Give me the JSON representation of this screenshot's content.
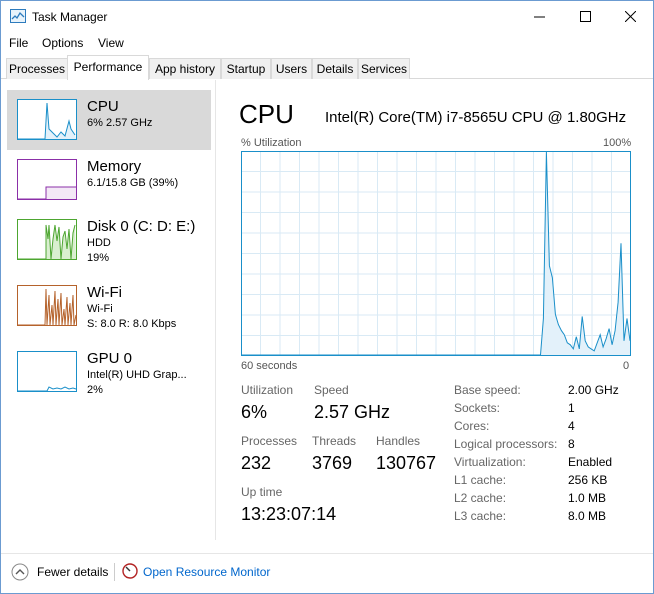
{
  "window": {
    "title": "Task Manager"
  },
  "menu": [
    "File",
    "Options",
    "View"
  ],
  "tabs": [
    "Processes",
    "Performance",
    "App history",
    "Startup",
    "Users",
    "Details",
    "Services"
  ],
  "active_tab": "Performance",
  "resources": [
    {
      "name": "CPU",
      "lines": [
        "6% 2.57 GHz"
      ],
      "color": "#1a8fc9"
    },
    {
      "name": "Memory",
      "lines": [
        "6.1/15.8 GB (39%)"
      ],
      "color": "#8b2fa8",
      "level": 0.39
    },
    {
      "name": "Disk 0 (C: D: E:)",
      "lines": [
        "HDD",
        "19%"
      ],
      "color": "#4da630"
    },
    {
      "name": "Wi-Fi",
      "lines": [
        "Wi-Fi",
        "S: 8.0 R: 8.0 Kbps"
      ],
      "color": "#b5622b"
    },
    {
      "name": "GPU 0",
      "lines": [
        "Intel(R) UHD Grap...",
        "2%"
      ],
      "color": "#1a8fc9"
    }
  ],
  "detail": {
    "title": "CPU",
    "model": "Intel(R) Core(TM) i7-8565U CPU @ 1.80GHz",
    "util_label": "% Utilization",
    "util_max": "100%",
    "axis_left": "60 seconds",
    "axis_right": "0",
    "stats": {
      "utilization_label": "Utilization",
      "utilization": "6%",
      "speed_label": "Speed",
      "speed": "2.57 GHz",
      "processes_label": "Processes",
      "processes": "232",
      "threads_label": "Threads",
      "threads": "3769",
      "handles_label": "Handles",
      "handles": "130767",
      "uptime_label": "Up time",
      "uptime": "13:23:07:14"
    },
    "specs": [
      {
        "label": "Base speed:",
        "value": "2.00 GHz"
      },
      {
        "label": "Sockets:",
        "value": "1"
      },
      {
        "label": "Cores:",
        "value": "4"
      },
      {
        "label": "Logical processors:",
        "value": "8"
      },
      {
        "label": "Virtualization:",
        "value": "Enabled"
      },
      {
        "label": "L1 cache:",
        "value": "256 KB"
      },
      {
        "label": "L2 cache:",
        "value": "1.0 MB"
      },
      {
        "label": "L3 cache:",
        "value": "8.0 MB"
      }
    ]
  },
  "cpu_history": [
    0,
    0,
    0,
    0,
    0,
    0,
    0,
    0,
    0,
    0,
    0,
    0,
    0,
    0,
    0,
    0,
    0,
    0,
    0,
    0,
    0,
    0,
    0,
    0,
    0,
    0,
    0,
    0,
    0,
    0,
    0,
    0,
    0,
    0,
    0,
    0,
    0,
    0,
    0,
    0,
    0,
    0,
    0,
    0,
    0,
    0,
    0,
    0,
    0,
    0,
    0,
    0,
    0,
    0,
    0,
    0,
    0,
    0,
    0,
    0,
    0,
    0,
    0,
    0,
    0,
    0,
    0,
    0,
    0,
    0,
    0,
    0,
    0,
    0,
    0,
    0,
    0,
    0,
    0,
    0,
    0,
    0,
    0,
    0,
    0,
    0,
    0,
    0,
    0,
    0,
    0,
    0,
    0,
    0,
    0,
    0,
    0,
    0,
    0,
    0,
    0,
    18,
    100,
    44,
    38,
    20,
    15,
    12,
    10,
    6,
    5,
    3,
    9,
    3,
    19,
    7,
    4,
    3,
    2,
    6,
    10,
    4,
    8,
    13,
    5,
    12,
    26,
    55,
    7,
    18,
    7
  ],
  "footer": {
    "fewer_details": "Fewer details",
    "open_rm": "Open Resource Monitor"
  },
  "colors": {
    "accent": "#1a8fc9",
    "link": "#0066cc"
  }
}
